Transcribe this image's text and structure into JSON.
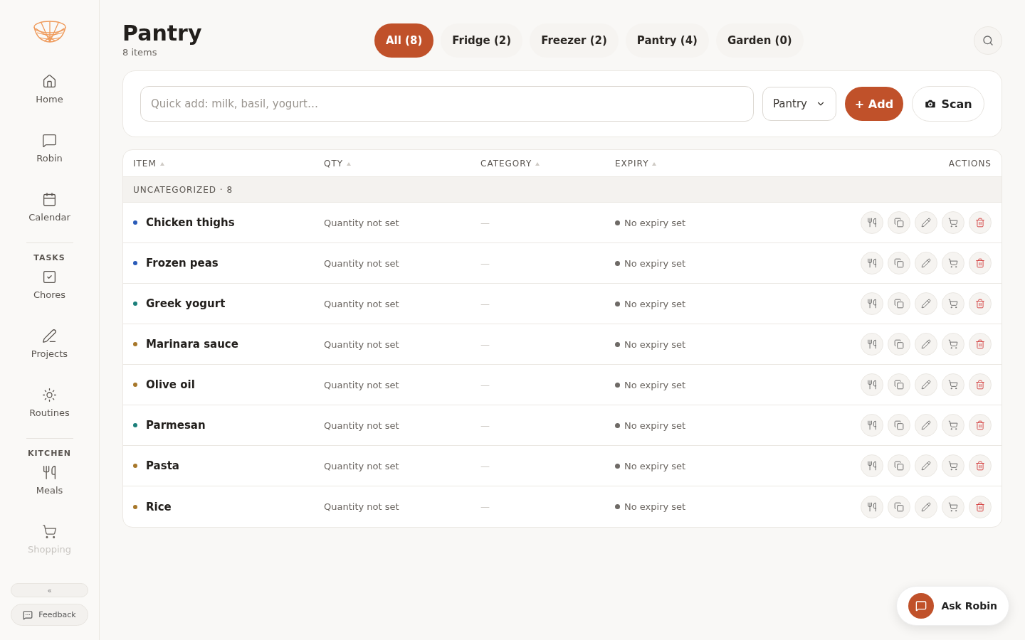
{
  "sidebar": {
    "top": [
      {
        "label": "Home"
      },
      {
        "label": "Robin"
      },
      {
        "label": "Calendar"
      }
    ],
    "sections": [
      {
        "title": "TASKS",
        "items": [
          {
            "label": "Chores"
          },
          {
            "label": "Projects"
          },
          {
            "label": "Routines"
          }
        ]
      },
      {
        "title": "KITCHEN",
        "items": [
          {
            "label": "Meals"
          },
          {
            "label": "Shopping"
          }
        ]
      }
    ],
    "collapse": "«",
    "feedback": "Feedback"
  },
  "header": {
    "title": "Pantry",
    "subtitle": "8 items"
  },
  "tabs": [
    {
      "label": "All (8)",
      "selected": true
    },
    {
      "label": "Fridge (2)",
      "selected": false
    },
    {
      "label": "Freezer (2)",
      "selected": false
    },
    {
      "label": "Pantry (4)",
      "selected": false
    },
    {
      "label": "Garden (0)",
      "selected": false
    }
  ],
  "quick_add": {
    "placeholder": "Quick add: milk, basil, yogurt…",
    "location": "Pantry",
    "add": "+ Add",
    "scan": "Scan"
  },
  "table": {
    "columns": [
      "ITEM",
      "QTY",
      "CATEGORY",
      "EXPIRY",
      "ACTIONS"
    ],
    "group": "UNCATEGORIZED · 8",
    "rows": [
      {
        "name": "Chicken thighs",
        "color": "#2a5bb8",
        "qty": "Quantity not set",
        "category": "—",
        "expiry": "No expiry set"
      },
      {
        "name": "Frozen peas",
        "color": "#2a5bb8",
        "qty": "Quantity not set",
        "category": "—",
        "expiry": "No expiry set"
      },
      {
        "name": "Greek yogurt",
        "color": "#1b7f7a",
        "qty": "Quantity not set",
        "category": "—",
        "expiry": "No expiry set"
      },
      {
        "name": "Marinara sauce",
        "color": "#a7772a",
        "qty": "Quantity not set",
        "category": "—",
        "expiry": "No expiry set"
      },
      {
        "name": "Olive oil",
        "color": "#a7772a",
        "qty": "Quantity not set",
        "category": "—",
        "expiry": "No expiry set"
      },
      {
        "name": "Parmesan",
        "color": "#1b7f7a",
        "qty": "Quantity not set",
        "category": "—",
        "expiry": "No expiry set"
      },
      {
        "name": "Pasta",
        "color": "#a7772a",
        "qty": "Quantity not set",
        "category": "—",
        "expiry": "No expiry set"
      },
      {
        "name": "Rice",
        "color": "#a7772a",
        "qty": "Quantity not set",
        "category": "—",
        "expiry": "No expiry set"
      }
    ]
  },
  "assistant": {
    "label": "Ask Robin"
  }
}
